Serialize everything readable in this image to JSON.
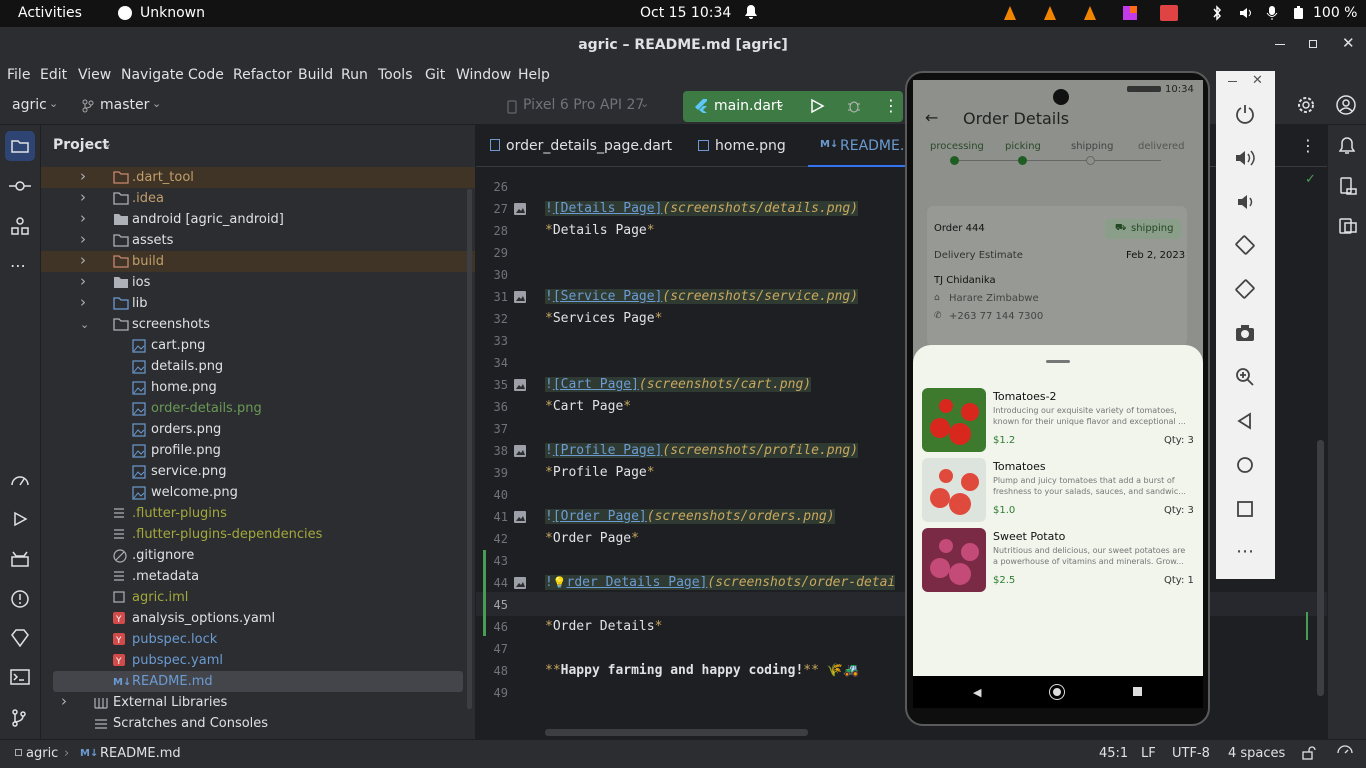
{
  "gnome_bar": {
    "activities": "Activities",
    "app_name": "Unknown",
    "datetime": "Oct 15  10:34",
    "battery": "100 %"
  },
  "window": {
    "title": "agric – README.md [agric]"
  },
  "menu": [
    "File",
    "Edit",
    "View",
    "Navigate",
    "Code",
    "Refactor",
    "Build",
    "Run",
    "Tools",
    "Git",
    "Window",
    "Help"
  ],
  "toolbar": {
    "project": "agric",
    "branch": "master",
    "device": "Pixel 6 Pro API 27",
    "run_config": "main.dart"
  },
  "project_panel": {
    "title": "Project",
    "rows": [
      {
        "label": ".dart_tool",
        "kind": "folder-excluded",
        "indent": 1,
        "expander": "right",
        "color": "#c29e6a"
      },
      {
        "label": ".idea",
        "kind": "folder",
        "indent": 1,
        "expander": "right",
        "color": "#c29e6a"
      },
      {
        "label": "android [agric_android]",
        "kind": "module",
        "indent": 1,
        "expander": "right",
        "color": "#dfe1e5"
      },
      {
        "label": "assets",
        "kind": "folder",
        "indent": 1,
        "expander": "right",
        "color": "#dfe1e5"
      },
      {
        "label": "build",
        "kind": "folder-excluded",
        "indent": 1,
        "expander": "right",
        "color": "#c29e6a"
      },
      {
        "label": "ios",
        "kind": "module",
        "indent": 1,
        "expander": "right",
        "color": "#dfe1e5"
      },
      {
        "label": "lib",
        "kind": "folder-src",
        "indent": 1,
        "expander": "right",
        "color": "#dfe1e5"
      },
      {
        "label": "screenshots",
        "kind": "folder",
        "indent": 1,
        "expander": "down",
        "color": "#dfe1e5"
      },
      {
        "label": "cart.png",
        "kind": "image",
        "indent": 2,
        "expander": "",
        "color": "#dfe1e5"
      },
      {
        "label": "details.png",
        "kind": "image",
        "indent": 2,
        "expander": "",
        "color": "#dfe1e5"
      },
      {
        "label": "home.png",
        "kind": "image",
        "indent": 2,
        "expander": "",
        "color": "#dfe1e5"
      },
      {
        "label": "order-details.png",
        "kind": "image",
        "indent": 2,
        "expander": "",
        "color": "#6a9955"
      },
      {
        "label": "orders.png",
        "kind": "image",
        "indent": 2,
        "expander": "",
        "color": "#dfe1e5"
      },
      {
        "label": "profile.png",
        "kind": "image",
        "indent": 2,
        "expander": "",
        "color": "#dfe1e5"
      },
      {
        "label": "service.png",
        "kind": "image",
        "indent": 2,
        "expander": "",
        "color": "#dfe1e5"
      },
      {
        "label": "welcome.png",
        "kind": "image",
        "indent": 2,
        "expander": "",
        "color": "#dfe1e5"
      },
      {
        "label": ".flutter-plugins",
        "kind": "text",
        "indent": 1,
        "expander": "",
        "color": "#a3a83c"
      },
      {
        "label": ".flutter-plugins-dependencies",
        "kind": "text",
        "indent": 1,
        "expander": "",
        "color": "#a3a83c"
      },
      {
        "label": ".gitignore",
        "kind": "ignore",
        "indent": 1,
        "expander": "",
        "color": "#dfe1e5"
      },
      {
        "label": ".metadata",
        "kind": "text",
        "indent": 1,
        "expander": "",
        "color": "#dfe1e5"
      },
      {
        "label": "agric.iml",
        "kind": "iml",
        "indent": 1,
        "expander": "",
        "color": "#a3a83c"
      },
      {
        "label": "analysis_options.yaml",
        "kind": "yaml",
        "indent": 1,
        "expander": "",
        "color": "#dfe1e5"
      },
      {
        "label": "pubspec.lock",
        "kind": "yaml",
        "indent": 1,
        "expander": "",
        "color": "#6b9bd2"
      },
      {
        "label": "pubspec.yaml",
        "kind": "yaml",
        "indent": 1,
        "expander": "",
        "color": "#6b9bd2"
      },
      {
        "label": "README.md",
        "kind": "markdown",
        "indent": 1,
        "expander": "",
        "color": "#6b9bd2"
      },
      {
        "label": "External Libraries",
        "kind": "library",
        "indent": 0,
        "expander": "right",
        "color": "#dfe1e5"
      },
      {
        "label": "Scratches and Consoles",
        "kind": "scratch",
        "indent": 0,
        "expander": "",
        "color": "#dfe1e5"
      }
    ]
  },
  "editor": {
    "tabs": [
      "order_details_page.dart",
      "home.png",
      "README.md"
    ],
    "lines": [
      {
        "n": "26",
        "text": "",
        "kind": "blank",
        "gutter_img": false
      },
      {
        "n": "27",
        "alt": "Details Page",
        "path": "screenshots/details.png",
        "kind": "image",
        "gutter_img": true
      },
      {
        "n": "28",
        "em": "Details Page",
        "kind": "em",
        "gutter_img": false
      },
      {
        "n": "29",
        "text": "",
        "kind": "blank",
        "gutter_img": false
      },
      {
        "n": "30",
        "text": "",
        "kind": "blank",
        "gutter_img": false
      },
      {
        "n": "31",
        "alt": "Service Page",
        "path": "screenshots/service.png",
        "kind": "image",
        "gutter_img": true
      },
      {
        "n": "32",
        "em": "Services Page",
        "kind": "em",
        "gutter_img": false
      },
      {
        "n": "33",
        "text": "",
        "kind": "blank",
        "gutter_img": false
      },
      {
        "n": "34",
        "text": "",
        "kind": "blank",
        "gutter_img": false
      },
      {
        "n": "35",
        "alt": "Cart Page",
        "path": "screenshots/cart.png",
        "kind": "image",
        "gutter_img": true
      },
      {
        "n": "36",
        "em": "Cart Page",
        "kind": "em",
        "gutter_img": false
      },
      {
        "n": "37",
        "text": "",
        "kind": "blank",
        "gutter_img": false
      },
      {
        "n": "38",
        "alt": "Profile Page",
        "path": "screenshots/profile.png",
        "kind": "image",
        "gutter_img": true
      },
      {
        "n": "39",
        "em": "Profile Page",
        "kind": "em",
        "gutter_img": false
      },
      {
        "n": "40",
        "text": "",
        "kind": "blank",
        "gutter_img": false
      },
      {
        "n": "41",
        "alt": "Order Page",
        "path": "screenshots/orders.png",
        "kind": "image",
        "gutter_img": true
      },
      {
        "n": "42",
        "em": "Order Page",
        "kind": "em",
        "gutter_img": false
      },
      {
        "n": "43",
        "text": "",
        "kind": "blank",
        "gutter_img": false
      },
      {
        "n": "44",
        "alt": "Order Details Page",
        "path": "screenshots/order-detai",
        "kind": "image-bulb",
        "gutter_img": true
      },
      {
        "n": "45",
        "text": "",
        "kind": "current",
        "gutter_img": false
      },
      {
        "n": "46",
        "em": "Order Details",
        "kind": "em",
        "gutter_img": false
      },
      {
        "n": "47",
        "text": "",
        "kind": "blank",
        "gutter_img": false
      },
      {
        "n": "48",
        "strong": "Happy farming and happy coding!",
        "emoji": "🌾🚜",
        "kind": "strong",
        "gutter_img": false
      },
      {
        "n": "49",
        "text": "",
        "kind": "blank",
        "gutter_img": false
      }
    ]
  },
  "status_bar": {
    "project": "agric",
    "file": "README.md",
    "position": "45:1",
    "line_sep": "LF",
    "encoding": "UTF-8",
    "indent": "4 spaces"
  },
  "phone": {
    "time": "10:34",
    "page_title": "Order Details",
    "steps": [
      "processing",
      "picking",
      "shipping",
      "delivered"
    ],
    "order_label": "Order 444",
    "status_chip": "shipping",
    "delivery_label": "Delivery Estimate",
    "delivery_date": "Feb 2, 2023",
    "customer": "TJ Chidanika",
    "address": "Harare Zimbabwe",
    "phone_number": "+263 77 144 7300",
    "items": [
      {
        "name": "Tomatoes-2",
        "desc1": "Introducing our exquisite variety of tomatoes,",
        "desc2": "known for their unique flavor and exceptional ...",
        "price": "$1.2",
        "qty": "Qty: 3",
        "img": "cherry-tomatoes"
      },
      {
        "name": "Tomatoes",
        "desc1": "Plump and juicy tomatoes that add a burst of",
        "desc2": "freshness to your salads, sauces, and sandwic...",
        "price": "$1.0",
        "qty": "Qty: 3",
        "img": "sliced-tomatoes"
      },
      {
        "name": "Sweet Potato",
        "desc1": "Nutritious and delicious, our sweet potatoes are",
        "desc2": "a powerhouse of vitamins and minerals. Grow...",
        "price": "$2.5",
        "qty": "Qty: 1",
        "img": "sweet-potatoes"
      }
    ]
  },
  "colors": {
    "accent_green": "#499c54",
    "link_blue": "#6b9bd2",
    "phone_green": "#2e7d32"
  }
}
